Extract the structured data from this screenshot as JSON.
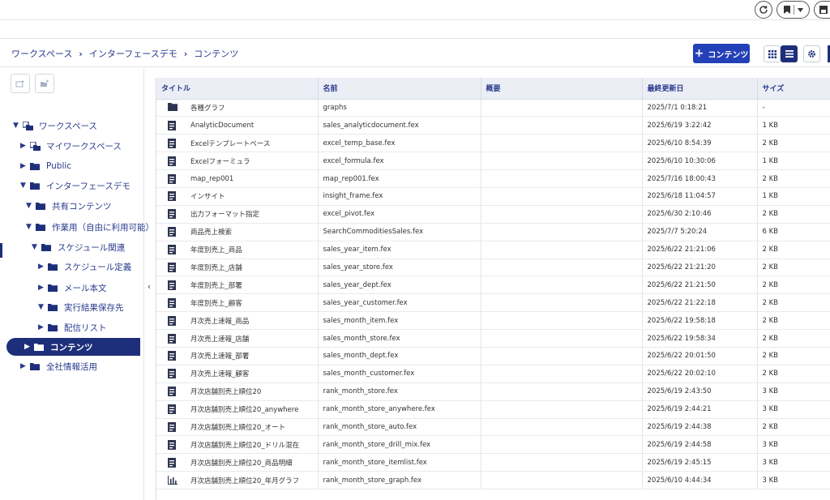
{
  "breadcrumb": [
    "ワークスペース",
    "インターフェースデモ",
    "コンテンツ"
  ],
  "toolbar": {
    "add_label": "コンテンツ"
  },
  "sidebar": {
    "items": [
      {
        "label": "ワークスペース",
        "indent": 0,
        "expanded": true,
        "icon": "workspace-icon"
      },
      {
        "label": "マイワークスペース",
        "indent": 1,
        "expanded": false,
        "icon": "workspace-icon"
      },
      {
        "label": "Public",
        "indent": 1,
        "expanded": false,
        "icon": "folder-icon"
      },
      {
        "label": "インターフェースデモ",
        "indent": 1,
        "expanded": true,
        "icon": "folder-icon"
      },
      {
        "label": "共有コンテンツ",
        "indent": 2,
        "expanded": true,
        "icon": "folder-icon"
      },
      {
        "label": "作業用（自由に利用可能）",
        "indent": 2,
        "expanded": true,
        "icon": "folder-icon"
      },
      {
        "label": "スケジュール関連",
        "indent": 3,
        "expanded": true,
        "icon": "folder-icon"
      },
      {
        "label": "スケジュール定義",
        "indent": 4,
        "expanded": false,
        "icon": "folder-icon"
      },
      {
        "label": "メール本文",
        "indent": 4,
        "expanded": false,
        "icon": "folder-icon"
      },
      {
        "label": "実行結果保存先",
        "indent": 4,
        "expanded": true,
        "icon": "folder-icon"
      },
      {
        "label": "配信リスト",
        "indent": 4,
        "expanded": false,
        "icon": "folder-icon"
      },
      {
        "label": "コンテンツ",
        "indent": 3,
        "expanded": false,
        "icon": "folder-icon",
        "selected": true
      },
      {
        "label": "全社情報活用",
        "indent": 1,
        "expanded": false,
        "icon": "folder-icon"
      }
    ]
  },
  "table": {
    "headers": [
      "タイトル",
      "名前",
      "概要",
      "最終更新日",
      "サイズ"
    ],
    "rows": [
      {
        "icon": "folder-icon",
        "title": "各種グラフ",
        "name": "graphs",
        "summary": "",
        "updated": "2025/7/1 0:18:21",
        "size": "-"
      },
      {
        "icon": "document-icon",
        "title": "AnalyticDocument",
        "name": "sales_analyticdocument.fex",
        "summary": "",
        "updated": "2025/6/19 3:22:42",
        "size": "1 KB"
      },
      {
        "icon": "document-icon",
        "title": "Excelテンプレートベース",
        "name": "excel_temp_base.fex",
        "summary": "",
        "updated": "2025/6/10 8:54:39",
        "size": "2 KB"
      },
      {
        "icon": "document-icon",
        "title": "Excelフォーミュラ",
        "name": "excel_formula.fex",
        "summary": "",
        "updated": "2025/6/10 10:30:06",
        "size": "1 KB"
      },
      {
        "icon": "document-icon",
        "title": "map_rep001",
        "name": "map_rep001.fex",
        "summary": "",
        "updated": "2025/7/16 18:00:43",
        "size": "2 KB"
      },
      {
        "icon": "document-icon",
        "title": "インサイト",
        "name": "insight_frame.fex",
        "summary": "",
        "updated": "2025/6/18 11:04:57",
        "size": "1 KB"
      },
      {
        "icon": "document-icon",
        "title": "出力フォーマット指定",
        "name": "excel_pivot.fex",
        "summary": "",
        "updated": "2025/6/30 2:10:46",
        "size": "2 KB"
      },
      {
        "icon": "document-icon",
        "title": "商品売上検索",
        "name": "SearchCommoditiesSales.fex",
        "summary": "",
        "updated": "2025/7/7 5:20:24",
        "size": "6 KB"
      },
      {
        "icon": "document-icon",
        "title": "年度別売上_商品",
        "name": "sales_year_item.fex",
        "summary": "",
        "updated": "2025/6/22 21:21:06",
        "size": "2 KB"
      },
      {
        "icon": "document-icon",
        "title": "年度別売上_店舗",
        "name": "sales_year_store.fex",
        "summary": "",
        "updated": "2025/6/22 21:21:20",
        "size": "2 KB"
      },
      {
        "icon": "document-icon",
        "title": "年度別売上_部署",
        "name": "sales_year_dept.fex",
        "summary": "",
        "updated": "2025/6/22 21:21:50",
        "size": "2 KB"
      },
      {
        "icon": "document-icon",
        "title": "年度別売上_顧客",
        "name": "sales_year_customer.fex",
        "summary": "",
        "updated": "2025/6/22 21:22:18",
        "size": "2 KB"
      },
      {
        "icon": "document-icon",
        "title": "月次売上速報_商品",
        "name": "sales_month_item.fex",
        "summary": "",
        "updated": "2025/6/22 19:58:18",
        "size": "2 KB"
      },
      {
        "icon": "document-icon",
        "title": "月次売上速報_店舗",
        "name": "sales_month_store.fex",
        "summary": "",
        "updated": "2025/6/22 19:58:34",
        "size": "2 KB"
      },
      {
        "icon": "document-icon",
        "title": "月次売上速報_部署",
        "name": "sales_month_dept.fex",
        "summary": "",
        "updated": "2025/6/22 20:01:50",
        "size": "2 KB"
      },
      {
        "icon": "document-icon",
        "title": "月次売上速報_顧客",
        "name": "sales_month_customer.fex",
        "summary": "",
        "updated": "2025/6/22 20:02:10",
        "size": "2 KB"
      },
      {
        "icon": "document-icon",
        "title": "月次店舗別売上順位20",
        "name": "rank_month_store.fex",
        "summary": "",
        "updated": "2025/6/19 2:43:50",
        "size": "3 KB"
      },
      {
        "icon": "document-icon",
        "title": "月次店舗別売上順位20_anywhere",
        "name": "rank_month_store_anywhere.fex",
        "summary": "",
        "updated": "2025/6/19 2:44:21",
        "size": "3 KB"
      },
      {
        "icon": "document-icon",
        "title": "月次店舗別売上順位20_オート",
        "name": "rank_month_store_auto.fex",
        "summary": "",
        "updated": "2025/6/19 2:44:38",
        "size": "2 KB"
      },
      {
        "icon": "document-icon",
        "title": "月次店舗別売上順位20_ドリル混在",
        "name": "rank_month_store_drill_mix.fex",
        "summary": "",
        "updated": "2025/6/19 2:44:58",
        "size": "3 KB"
      },
      {
        "icon": "document-icon",
        "title": "月次店舗別売上順位20_商品明細",
        "name": "rank_month_store_itemlist.fex",
        "summary": "",
        "updated": "2025/6/19 2:45:15",
        "size": "3 KB"
      },
      {
        "icon": "chart-icon",
        "title": "月次店舗別売上順位20_年月グラフ",
        "name": "rank_month_store_graph.fex",
        "summary": "",
        "updated": "2025/6/10 4:44:34",
        "size": "3 KB"
      }
    ]
  },
  "colors": {
    "accent": "#2440b8",
    "nav_dark": "#1d2f7a",
    "header_bg": "#eceef6",
    "link_text": "#2a3a8c"
  }
}
